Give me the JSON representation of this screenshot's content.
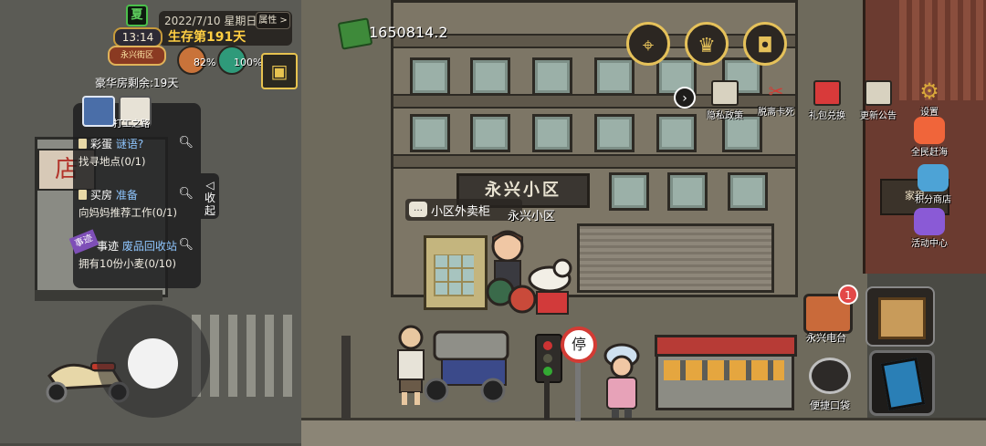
{
  "hud": {
    "season": "夏",
    "time": "13:14",
    "banner": "永兴街区",
    "date": "2022/7/10 星期日",
    "survive_days": "生存第191天",
    "attr_button": "属性 >",
    "hunger_pct": "82%",
    "health_pct": "100%",
    "bag_icon": "bag-icon",
    "luxury_room": "豪华房剩余:19天"
  },
  "task_panel": {
    "tab_label": "打工之路",
    "collapse_label": "收起",
    "tasks": [
      {
        "prefix": "彩蛋",
        "highlight": "谜语?",
        "detail": "找寻地点(0/1)"
      },
      {
        "prefix": "买房",
        "highlight": "准备",
        "detail": "向妈妈推荐工作(0/1)"
      },
      {
        "ribbon": "事迹",
        "prefix": "事迹",
        "highlight": "废品回收站",
        "detail": "拥有10份小麦(0/10)"
      }
    ]
  },
  "money": "1650814.2",
  "top_circle_buttons": [
    {
      "icon": "map-icon"
    },
    {
      "icon": "trophy-icon"
    },
    {
      "icon": "backpack-icon"
    }
  ],
  "top_icons": [
    {
      "label": "隐私政策",
      "icon": "document-icon"
    },
    {
      "label": "脱离卡死",
      "icon": "unstuck-icon"
    },
    {
      "label": "礼包兑换",
      "icon": "gift-icon"
    },
    {
      "label": "更新公告",
      "icon": "announcement-icon"
    },
    {
      "label": "设置",
      "icon": "gear-icon"
    }
  ],
  "side_icons": [
    {
      "label": "全民赶海",
      "icon": "crab-icon"
    },
    {
      "label": "积分商店",
      "icon": "shop-icon"
    },
    {
      "label": "活动中心",
      "icon": "tv-icon"
    }
  ],
  "scene": {
    "entrance_sign": "永兴小区",
    "shop_sign": "店",
    "right_sign": "家租",
    "object_label_badge": "…",
    "object_label": "小区外卖柜",
    "location_label": "永兴小区",
    "no_parking": "停"
  },
  "bottom_right": {
    "radio_label": "永兴电台",
    "radio_badge": "1",
    "quick_label": "便捷口袋"
  },
  "colors": {
    "accent_gold": "#e5c15a",
    "survive_text": "#ffcf43",
    "task_highlight": "#8fc6ff",
    "badge_red": "#e34848"
  }
}
